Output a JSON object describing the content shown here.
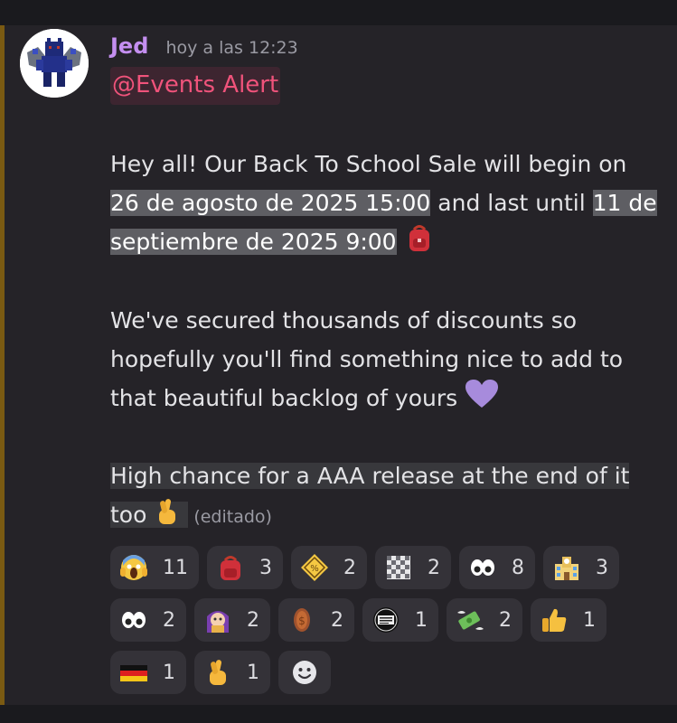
{
  "message": {
    "author": "Jed",
    "timestamp": "hoy a las 12:23",
    "mention": "@Events Alert",
    "paragraph1": {
      "text_a": "Hey all! Our Back To School Sale will begin on ",
      "date_start": "26 de agosto de 2025 15:00",
      "text_b": " and last until ",
      "date_end": "11 de septiembre de 2025 9:00"
    },
    "paragraph2": {
      "text": "We've secured thousands of discounts so hopefully you'll find something nice to add to that beautiful backlog of yours"
    },
    "paragraph3": {
      "text": "High chance for a AAA release at the end of it too"
    },
    "edited_label": "(editado)"
  },
  "reactions": [
    {
      "icon": "screaming-face-icon",
      "count": "11"
    },
    {
      "icon": "backpack-icon",
      "count": "3"
    },
    {
      "icon": "discount-sign-icon",
      "count": "2"
    },
    {
      "icon": "checker-pattern-icon",
      "count": "2"
    },
    {
      "icon": "eyes-icon",
      "count": "8"
    },
    {
      "icon": "school-icon",
      "count": "3"
    },
    {
      "icon": "eyes-icon",
      "count": "2"
    },
    {
      "icon": "anime-character-icon",
      "count": "2"
    },
    {
      "icon": "bronze-coin-icon",
      "count": "2"
    },
    {
      "icon": "good-old-games-badge-icon",
      "count": "1"
    },
    {
      "icon": "money-flying-icon",
      "count": "2"
    },
    {
      "icon": "thumbs-up-icon",
      "count": "1"
    },
    {
      "icon": "germany-flag-icon",
      "count": "1"
    },
    {
      "icon": "crossed-fingers-icon",
      "count": "1"
    }
  ],
  "colors": {
    "author": "#c48ff0",
    "mention": "#f0537b",
    "accent_bar": "#7a5a12"
  }
}
